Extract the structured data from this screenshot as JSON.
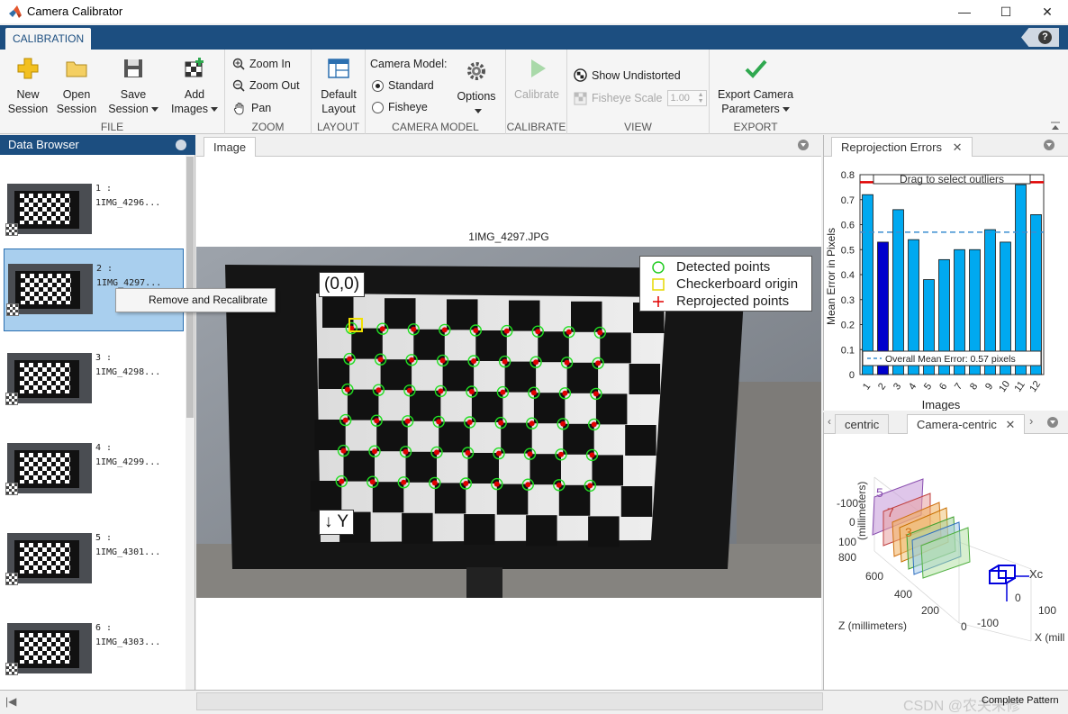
{
  "window": {
    "title": "Camera Calibrator",
    "minimize": "—",
    "maximize": "☐",
    "close": "✕"
  },
  "ribbon": {
    "tab": "CALIBRATION",
    "help": "?",
    "file": {
      "label": "FILE",
      "new_session": [
        "New",
        "Session"
      ],
      "open_session": [
        "Open",
        "Session"
      ],
      "save_session": [
        "Save",
        "Session"
      ],
      "add_images": [
        "Add",
        "Images"
      ]
    },
    "zoom": {
      "label": "ZOOM",
      "zoom_in": "Zoom In",
      "zoom_out": "Zoom Out",
      "pan": "Pan"
    },
    "layout": {
      "label": "LAYOUT",
      "default_layout": [
        "Default",
        "Layout"
      ]
    },
    "camera_model": {
      "label": "CAMERA MODEL",
      "title": "Camera Model:",
      "standard": "Standard",
      "fisheye": "Fisheye",
      "options": "Options",
      "selected": "Standard"
    },
    "calibrate": {
      "label": "CALIBRATE",
      "calibrate": "Calibrate"
    },
    "view": {
      "label": "VIEW",
      "show_undistorted": "Show Undistorted",
      "fisheye_scale": "Fisheye Scale",
      "fisheye_scale_value": "1.00"
    },
    "export": {
      "label": "EXPORT",
      "export_params": [
        "Export Camera",
        "Parameters"
      ]
    }
  },
  "data_browser": {
    "title": "Data Browser",
    "items": [
      {
        "index": "1 :",
        "name": "1IMG_4296..."
      },
      {
        "index": "2 :",
        "name": "1IMG_4297..."
      },
      {
        "index": "3 :",
        "name": "1IMG_4298..."
      },
      {
        "index": "4 :",
        "name": "1IMG_4299..."
      },
      {
        "index": "5 :",
        "name": "1IMG_4301..."
      },
      {
        "index": "6 :",
        "name": "1IMG_4303..."
      }
    ],
    "selected_index": 2,
    "context_menu": "Remove and Recalibrate"
  },
  "image_panel": {
    "tab": "Image",
    "image_title": "1IMG_4297.JPG",
    "origin_label": "(0,0)",
    "y_label": "↓ Y",
    "legend": [
      "Detected points",
      "Checkerboard origin",
      "Reprojected points"
    ]
  },
  "reprojection_panel": {
    "tab": "Reprojection Errors",
    "drag_hint": "Drag to select outliers",
    "overall_mean": "Overall Mean Error: 0.57 pixels",
    "colors": {
      "bar": "#00a9f0",
      "selected_bar": "#0000cc",
      "threshold": "#e00000",
      "mean_line": "#3b8fd1"
    }
  },
  "extrinsics_panel": {
    "tabs": [
      "centric",
      "Camera-centric"
    ],
    "active_tab": "Camera-centric",
    "y_axis_label": "(millimeters)",
    "z_axis_label": "Z (millimeters)",
    "x_axis_label": "X (mill",
    "y_ticks": [
      "-100",
      "0",
      "100"
    ],
    "z_ticks": [
      "800",
      "600",
      "400",
      "200",
      "0"
    ],
    "x_ticks": [
      "-100",
      "0",
      "100"
    ],
    "axis_xc": "Xc",
    "board_labels": [
      "5",
      "7",
      "3"
    ]
  },
  "status_bar": {
    "right_text": "Complete Pattern",
    "watermark": "CSDN @农夫未修"
  },
  "chart_data": {
    "type": "bar",
    "title": "",
    "xlabel": "Images",
    "ylabel": "Mean Error in Pixels",
    "categories": [
      "1",
      "2",
      "3",
      "4",
      "5",
      "6",
      "7",
      "8",
      "9",
      "10",
      "11",
      "12"
    ],
    "values": [
      0.72,
      0.53,
      0.66,
      0.54,
      0.38,
      0.46,
      0.5,
      0.5,
      0.58,
      0.53,
      0.76,
      0.64
    ],
    "selected_category": "2",
    "ylim": [
      0,
      0.8
    ],
    "yticks": [
      "0",
      "0.1",
      "0.2",
      "0.3",
      "0.4",
      "0.5",
      "0.6",
      "0.7",
      "0.8"
    ],
    "threshold": 0.77,
    "overall_mean": 0.57,
    "grid": false,
    "legend": "bottom"
  }
}
